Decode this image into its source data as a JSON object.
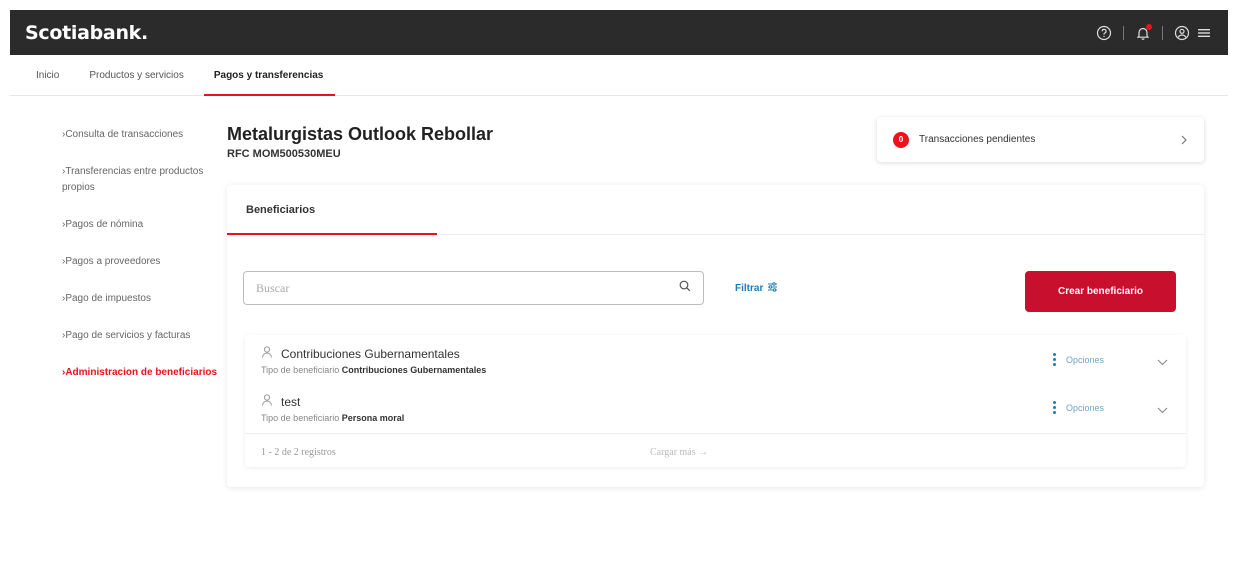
{
  "header": {
    "logo": "Scotiabank."
  },
  "nav": {
    "items": [
      "Inicio",
      "Productos y servicios",
      "Pagos y transferencias"
    ],
    "active_index": 2
  },
  "sidebar": {
    "items": [
      "›Consulta de transacciones",
      "›Transferencias entre productos propios",
      "›Pagos de nómina",
      "›Pagos a proveedores",
      "›Pago de impuestos",
      "›Pago de servicios y facturas",
      "›Administracion de beneficiarios"
    ],
    "active_index": 6
  },
  "company": {
    "name": "Metalurgistas Outlook Rebollar",
    "rfc": "RFC MOM500530MEU"
  },
  "pending": {
    "badge": "0",
    "label": "Transacciones pendientes"
  },
  "tabs": [
    "Beneficiarios"
  ],
  "search": {
    "placeholder": "Buscar"
  },
  "filter_label": "Filtrar",
  "create_button": "Crear beneficiario",
  "beneficiaries": [
    {
      "name": "Contribuciones Gubernamentales",
      "type_label": "Tipo de beneficiario",
      "type_value": "Contribuciones Gubernamentales",
      "options": "Opciones"
    },
    {
      "name": "test",
      "type_label": "Tipo de beneficiario",
      "type_value": "Persona moral",
      "options": "Opciones"
    }
  ],
  "pagination": {
    "summary": "1 - 2 de 2 registros",
    "load_more": "Cargar más →"
  },
  "colors": {
    "brand_red": "#ec111a",
    "button_red": "#c8102e",
    "link_blue": "#1f7bb6",
    "topbar": "#2b2b2b"
  }
}
